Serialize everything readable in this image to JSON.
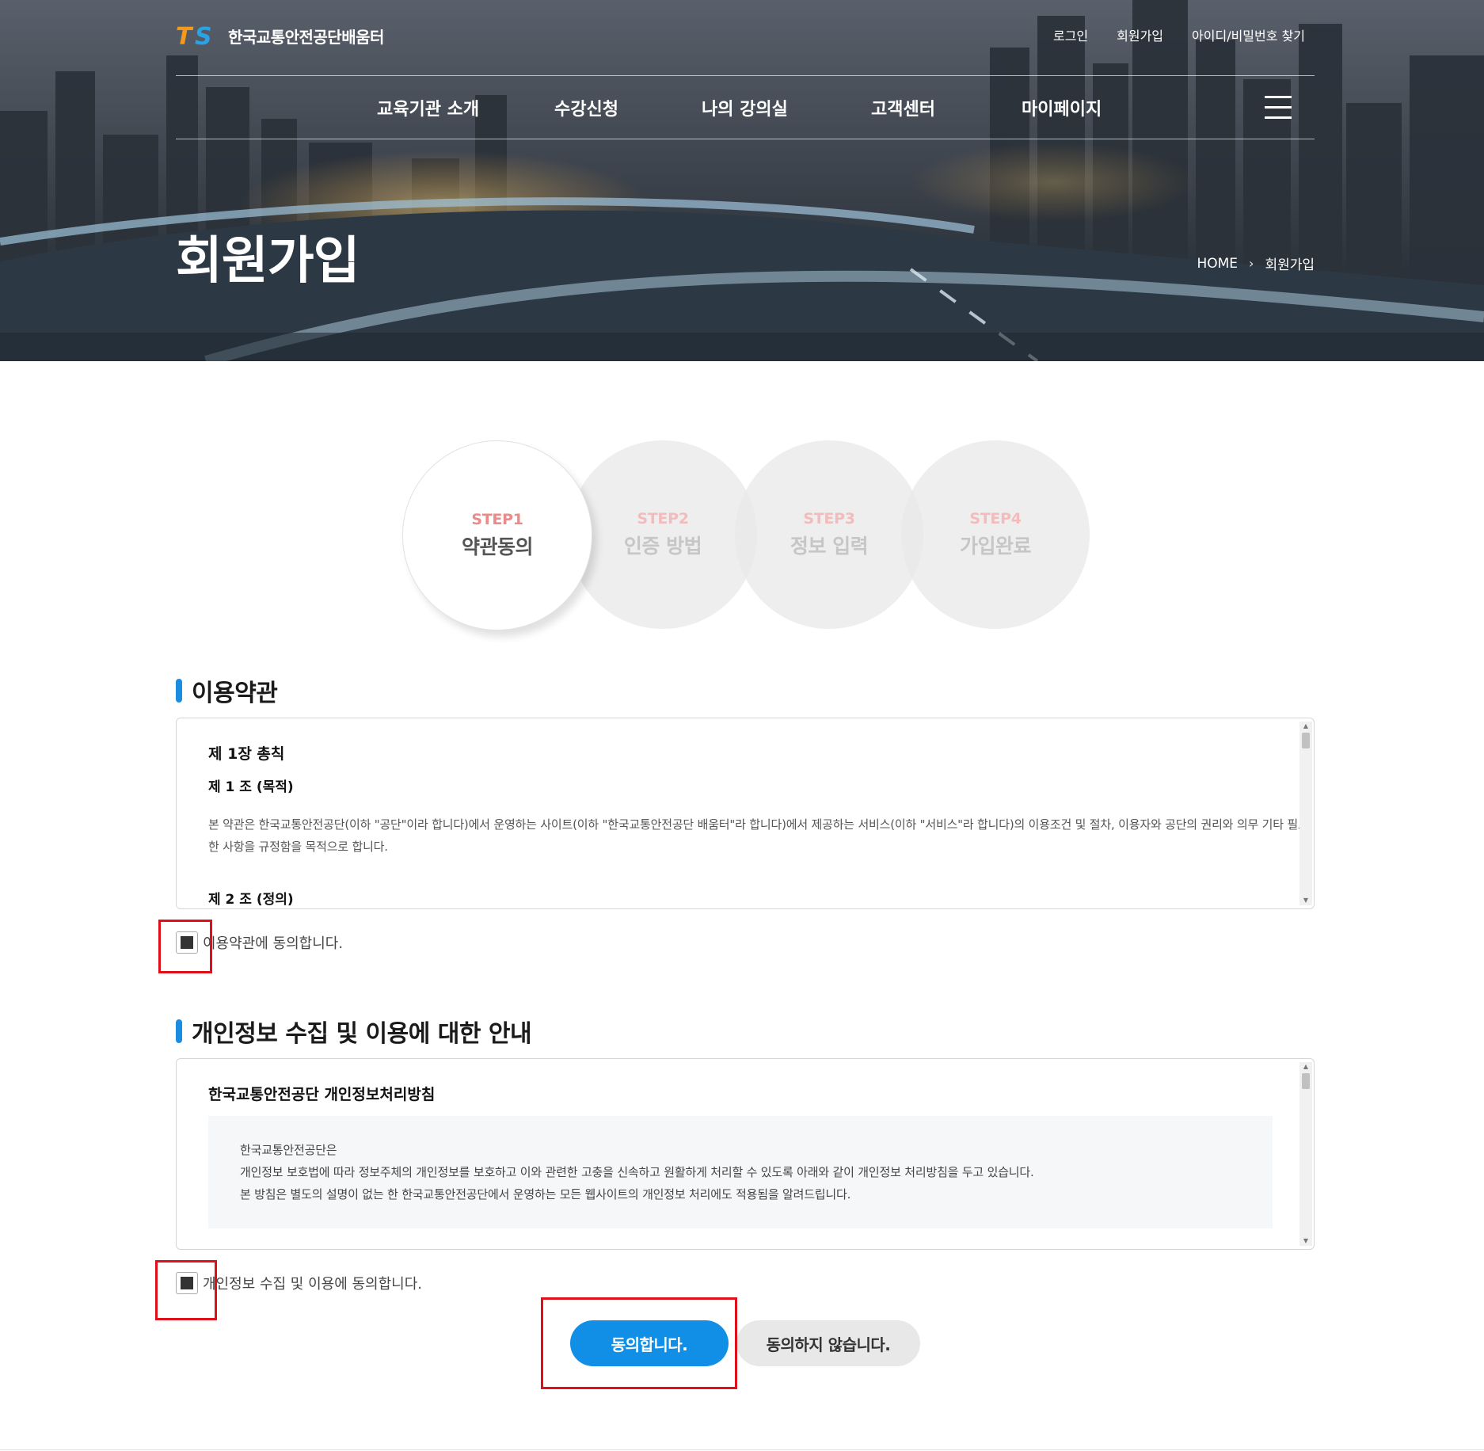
{
  "header": {
    "logo_mark": "TS",
    "logo_text": "한국교통안전공단배움터",
    "util_links": [
      "로그인",
      "회원가입",
      "아이디/비밀번호 찾기"
    ],
    "nav": [
      "교육기관 소개",
      "수강신청",
      "나의 강의실",
      "고객센터",
      "마이페이지"
    ]
  },
  "hero": {
    "title": "회원가입",
    "breadcrumb": [
      "HOME",
      "회원가입"
    ]
  },
  "steps": [
    {
      "num": "STEP1",
      "name": "약관동의",
      "active": true
    },
    {
      "num": "STEP2",
      "name": "인증 방법",
      "active": false
    },
    {
      "num": "STEP3",
      "name": "정보 입력",
      "active": false
    },
    {
      "num": "STEP4",
      "name": "가입완료",
      "active": false
    }
  ],
  "terms": {
    "title": "이용약관",
    "chapter": "제 1장 총칙",
    "article1": "제 1 조 (목적)",
    "article1_body": "본 약관은 한국교통안전공단(이하 \"공단\"이라 합니다)에서 운영하는 사이트(이하 \"한국교통안전공단 배움터\"라 합니다)에서 제공하는 서비스(이하 \"서비스\"라 합니다)의 이용조건 및 절차, 이용자와 공단의 권리와 의무 기타 필요한 사항을 규정함을 목적으로 합니다.",
    "article2": "제 2 조 (정의)",
    "agree_label": "이용약관에 동의합니다."
  },
  "privacy": {
    "title": "개인정보 수집 및 이용에 대한 안내",
    "policy_title": "한국교통안전공단 개인정보처리방침",
    "notice": [
      "한국교통안전공단은",
      "개인정보 보호법에 따라 정보주체의 개인정보를 보호하고 이와 관련한 고충을 신속하고 원활하게 처리할 수 있도록 아래와 같이 개인정보 처리방침을 두고 있습니다.",
      "본 방침은 별도의 설명이 없는 한 한국교통안전공단에서 운영하는 모든 웹사이트의 개인정보 처리에도 적용됨을 알려드립니다."
    ],
    "agree_label": "개인정보 수집 및 이용에 동의합니다."
  },
  "buttons": {
    "agree": "동의합니다.",
    "decline": "동의하지 않습니다."
  },
  "colors": {
    "accent_blue": "#118ee6",
    "section_bar": "#1a8de0",
    "highlight_red": "#e0101a",
    "step_label": "#ea8a8a",
    "logo_orange": "#f39a1d",
    "logo_blue": "#2aa3e6"
  },
  "icons": [
    "hamburger-menu-icon",
    "breadcrumb-chevron-icon",
    "scroll-up-icon",
    "scroll-down-icon"
  ]
}
